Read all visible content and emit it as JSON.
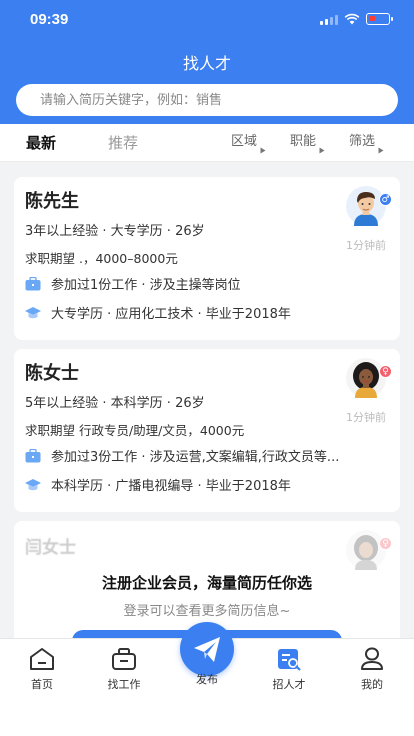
{
  "status_bar": {
    "time": "09:39"
  },
  "header": {
    "title": "找人才",
    "search_placeholder": "请输入简历关键字，例如：销售"
  },
  "tabs": {
    "latest": "最新",
    "recommended": "推荐"
  },
  "filters": {
    "region": "区域",
    "position": "职能",
    "filter": "筛选"
  },
  "candidates": [
    {
      "name": "陈先生",
      "meta": "3年以上经验 · 大专学历 · 26岁",
      "expectation": "求职期望 .，4000–8000元",
      "experience": "参加过1份工作 · 涉及主操等岗位",
      "education": "大专学历 · 应用化工技术 · 毕业于2018年",
      "time_ago": "1分钟前",
      "gender": "male",
      "gender_symbol": "♂"
    },
    {
      "name": "陈女士",
      "meta": "5年以上经验 · 本科学历 · 26岁",
      "expectation": "求职期望 行政专员/助理/文员，4000元",
      "experience": "参加过3份工作 · 涉及运营,文案编辑,行政文员等...",
      "education": "本科学历 · 广播电视编导 · 毕业于2018年",
      "time_ago": "1分钟前",
      "gender": "female",
      "gender_symbol": "♀"
    }
  ],
  "locked_card": {
    "blurred_name": "闫女士",
    "title": "注册企业会员，海量简历任你选",
    "subtitle": "登录可以查看更多简历信息~"
  },
  "tab_bar": {
    "home": "首页",
    "find_job": "找工作",
    "publish": "发布",
    "recruit": "招人才",
    "mine": "我的"
  },
  "colors": {
    "primary": "#3b7ff0",
    "male_badge": "#3b7ff0",
    "female_badge": "#f4606c"
  }
}
